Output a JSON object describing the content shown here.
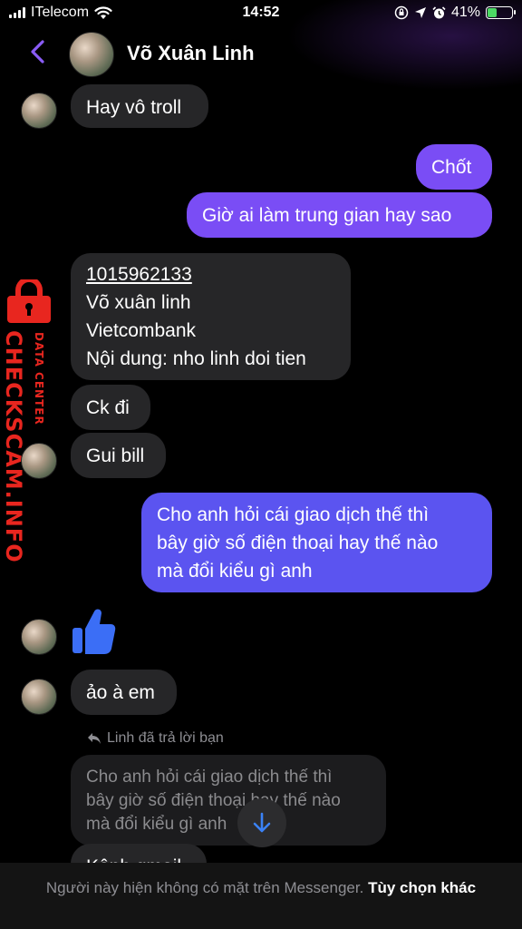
{
  "status_bar": {
    "carrier": "ITelecom",
    "time": "14:52",
    "battery_percent": "41%",
    "battery_level": 0.41,
    "icons": [
      "signal-icon",
      "wifi-icon",
      "orientation-lock-icon",
      "location-icon",
      "alarm-icon",
      "battery-icon"
    ]
  },
  "header": {
    "contact_name": "Võ Xuân Linh",
    "back_icon": "chevron-left-icon",
    "accent_color": "#8a5cf6"
  },
  "messages": [
    {
      "from": "them",
      "text": "Hay vô troll"
    },
    {
      "from": "me",
      "text": "Chốt"
    },
    {
      "from": "me",
      "text": "Giờ ai làm trung gian hay sao"
    },
    {
      "from": "them",
      "lines": [
        "1015962133",
        "Võ xuân linh",
        "Vietcombank",
        "Nội dung: nho linh doi tien"
      ]
    },
    {
      "from": "them",
      "text": "Ck đi"
    },
    {
      "from": "them",
      "text": "Gui bill"
    },
    {
      "from": "me",
      "lines": [
        "Cho anh hỏi cái giao dịch thế thì",
        "bây giờ số điện thoại hay thế nào",
        "mà đổi kiểu gì anh"
      ]
    },
    {
      "from": "them",
      "icon": "thumbs-up-icon"
    },
    {
      "from": "them",
      "text": "ảo à em"
    }
  ],
  "reply": {
    "label": "Linh đã trả lời bạn",
    "quoted_lines": [
      "Cho anh hỏi cái giao dịch thế thì",
      "bây giờ số điện thoại hay thế nào",
      "mà đổi kiểu gì anh"
    ],
    "partial_next": "Kênh gmail"
  },
  "footer": {
    "notice": "Người này hiện không có mặt trên Messenger.",
    "action": "Tùy chọn khác"
  },
  "watermark": {
    "main": "CHECKSCAM.INFO",
    "sub": "DATA CENTER",
    "color": "#e8261f"
  },
  "colors": {
    "outgoing_purple": "#7a4df5",
    "outgoing_blue": "#5b54f0",
    "incoming": "#262628",
    "thumbs_up": "#3b6ef6"
  }
}
